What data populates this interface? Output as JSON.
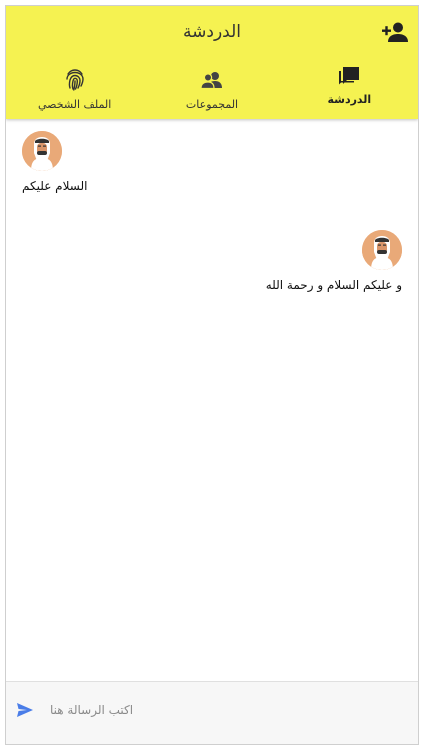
{
  "header": {
    "title": "الدردشة",
    "add_user_icon": "person-add-icon"
  },
  "tabs": [
    {
      "label": "الدردشة",
      "icon": "chat-bubbles-icon",
      "active": true
    },
    {
      "label": "المجموعات",
      "icon": "groups-icon",
      "active": false
    },
    {
      "label": "الملف الشخصي",
      "icon": "fingerprint-icon",
      "active": false
    }
  ],
  "messages": [
    {
      "side": "left",
      "text": "السلام عليكم",
      "avatar": "user-avatar"
    },
    {
      "side": "right",
      "text": "و عليكم السلام و رحمة الله",
      "avatar": "user-avatar"
    }
  ],
  "composer": {
    "placeholder": "اكتب الرسالة هنا",
    "value": "",
    "send_icon": "send-icon"
  },
  "colors": {
    "appbar": "#f5f251",
    "send": "#4a7de8",
    "avatar_bg": "#e9a978"
  }
}
